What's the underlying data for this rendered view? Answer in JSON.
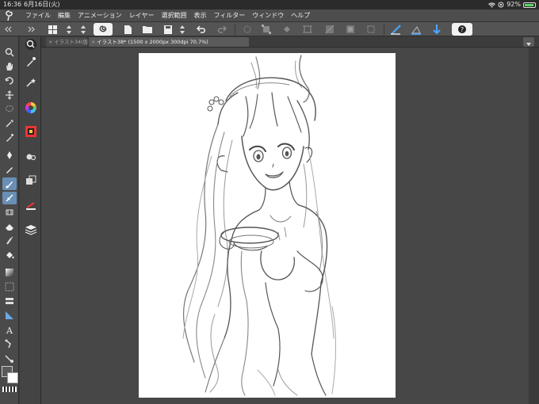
{
  "status_bar": {
    "time": "16:36",
    "date": "6月16日(火)",
    "battery": "92%",
    "battery_level": 0.92
  },
  "menu": {
    "items": [
      "ファイル",
      "編集",
      "アニメーション",
      "レイヤー",
      "選択範囲",
      "表示",
      "フィルター",
      "ウィンドウ",
      "ヘルプ"
    ]
  },
  "tabs": [
    {
      "label": "イラスト34(仮",
      "active": false
    },
    {
      "label": "イラスト38* (1500 x 2000px 300dpi 70.7%)",
      "active": true
    }
  ],
  "colors": {
    "accent": "#6a8fb5",
    "canvas_bg": "#474747",
    "paper": "#ffffff",
    "toolbar": "#545454"
  }
}
